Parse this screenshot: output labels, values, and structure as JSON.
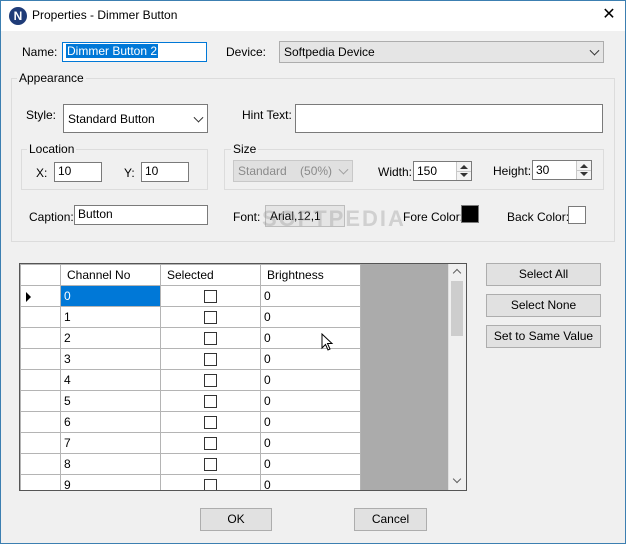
{
  "window": {
    "title": "Properties - Dimmer Button",
    "icon_letter": "N",
    "close_glyph": "✕"
  },
  "form": {
    "name_label": "Name:",
    "name_value": "Dimmer Button 2",
    "device_label": "Device:",
    "device_value": "Softpedia Device",
    "appearance_label": "Appearance",
    "style_label": "Style:",
    "style_value": "Standard Button",
    "hint_label": "Hint Text:",
    "hint_value": "",
    "location_label": "Location",
    "x_label": "X:",
    "x_value": "10",
    "y_label": "Y:",
    "y_value": "10",
    "size_label": "Size",
    "size_value": "Standard    (50%)",
    "width_label": "Width:",
    "width_value": "150",
    "height_label": "Height:",
    "height_value": "30",
    "caption_label": "Caption:",
    "caption_value": "Button",
    "font_label": "Font:",
    "font_value": "Arial,12,1",
    "fore_color_label": "Fore Color:",
    "fore_color": "#000000",
    "back_color_label": "Back Color:",
    "back_color": "#ffffff"
  },
  "grid": {
    "columns": [
      "Channel No",
      "Selected",
      "Brightness"
    ],
    "rows": [
      {
        "channel": "0",
        "brightness": "0"
      },
      {
        "channel": "1",
        "brightness": "0"
      },
      {
        "channel": "2",
        "brightness": "0"
      },
      {
        "channel": "3",
        "brightness": "0"
      },
      {
        "channel": "4",
        "brightness": "0"
      },
      {
        "channel": "5",
        "brightness": "0"
      },
      {
        "channel": "6",
        "brightness": "0"
      },
      {
        "channel": "7",
        "brightness": "0"
      },
      {
        "channel": "8",
        "brightness": "0"
      },
      {
        "channel": "9",
        "brightness": "0"
      }
    ]
  },
  "buttons": {
    "select_all": "Select All",
    "select_none": "Select None",
    "set_same": "Set to Same Value",
    "ok": "OK",
    "cancel": "Cancel"
  },
  "watermark": "SOFTPEDIA"
}
